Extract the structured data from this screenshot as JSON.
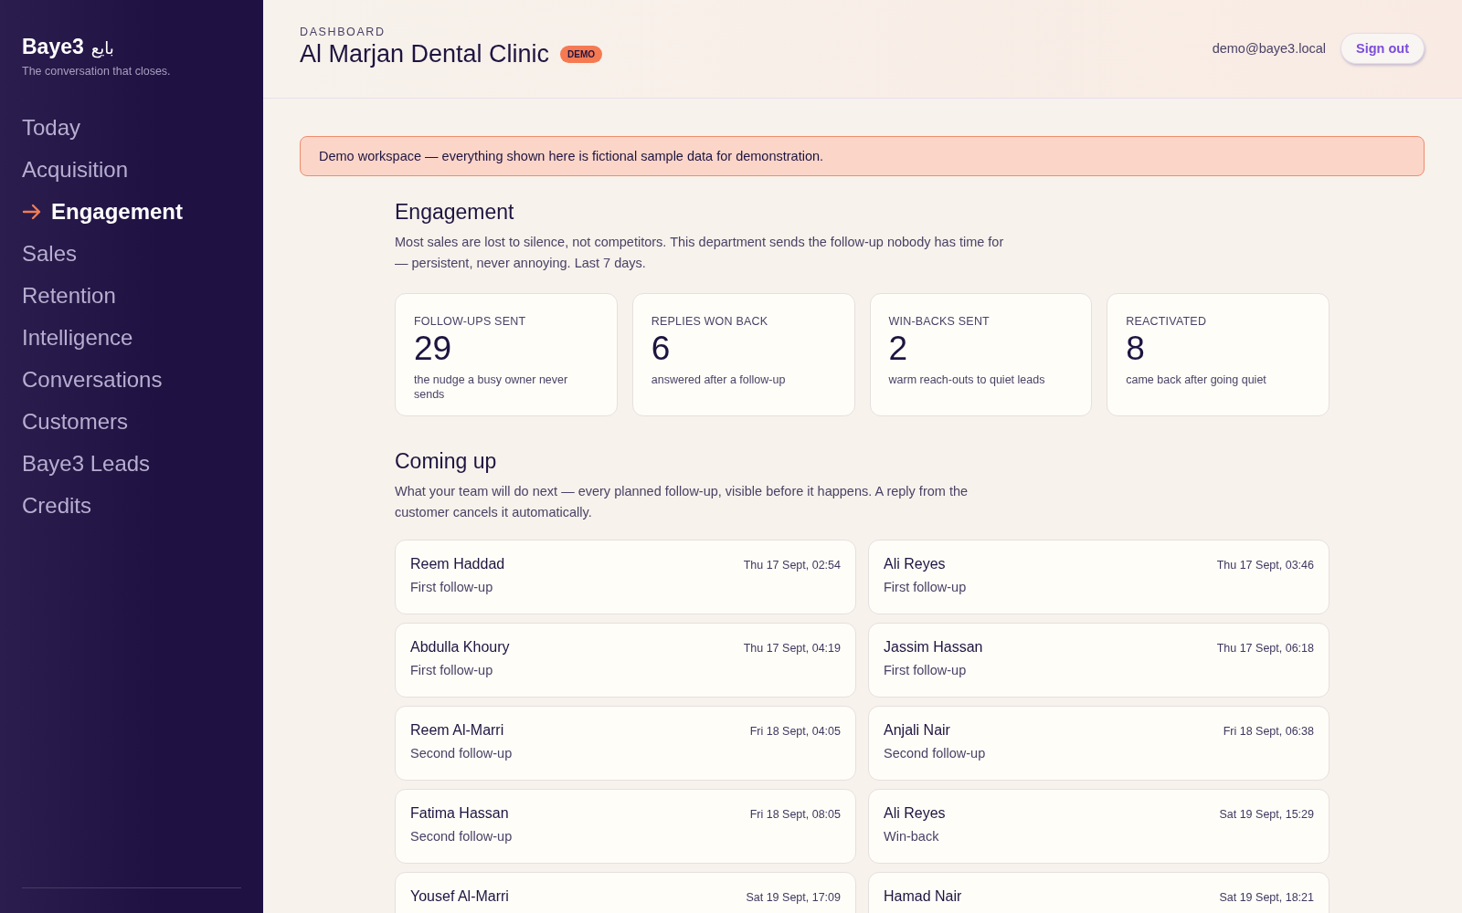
{
  "brand": {
    "name": "Baye3",
    "arabic": "بايع",
    "tagline": "The conversation that closes."
  },
  "nav": [
    {
      "label": "Today",
      "selected": false
    },
    {
      "label": "Acquisition",
      "selected": false
    },
    {
      "label": "Engagement",
      "selected": true
    },
    {
      "label": "Sales",
      "selected": false
    },
    {
      "label": "Retention",
      "selected": false
    },
    {
      "label": "Intelligence",
      "selected": false
    },
    {
      "label": "Conversations",
      "selected": false
    },
    {
      "label": "Customers",
      "selected": false
    },
    {
      "label": "Baye3 Leads",
      "selected": false
    },
    {
      "label": "Credits",
      "selected": false
    }
  ],
  "header": {
    "eyebrow": "DASHBOARD",
    "title": "Al Marjan Dental Clinic",
    "badge": "DEMO",
    "email": "demo@baye3.local",
    "sign_out": "Sign out"
  },
  "banner": "Demo workspace — everything shown here is fictional sample data for demonstration.",
  "engagement": {
    "title": "Engagement",
    "description": "Most sales are lost to silence, not competitors. This department sends the follow-up nobody has time for — persistent, never annoying. Last 7 days.",
    "stats": [
      {
        "label": "FOLLOW-UPS SENT",
        "value": "29",
        "note": "the nudge a busy owner never sends"
      },
      {
        "label": "REPLIES WON BACK",
        "value": "6",
        "note": "answered after a follow-up"
      },
      {
        "label": "WIN-BACKS SENT",
        "value": "2",
        "note": "warm reach-outs to quiet leads"
      },
      {
        "label": "REACTIVATED",
        "value": "8",
        "note": "came back after going quiet"
      }
    ]
  },
  "coming_up": {
    "title": "Coming up",
    "description": "What your team will do next — every planned follow-up, visible before it happens. A reply from the customer cancels it automatically.",
    "items": [
      {
        "name": "Reem Haddad",
        "time": "Thu 17 Sept, 02:54",
        "step": "First follow-up"
      },
      {
        "name": "Ali Reyes",
        "time": "Thu 17 Sept, 03:46",
        "step": "First follow-up"
      },
      {
        "name": "Abdulla Khoury",
        "time": "Thu 17 Sept, 04:19",
        "step": "First follow-up"
      },
      {
        "name": "Jassim Hassan",
        "time": "Thu 17 Sept, 06:18",
        "step": "First follow-up"
      },
      {
        "name": "Reem Al-Marri",
        "time": "Fri 18 Sept, 04:05",
        "step": "Second follow-up"
      },
      {
        "name": "Anjali Nair",
        "time": "Fri 18 Sept, 06:38",
        "step": "Second follow-up"
      },
      {
        "name": "Fatima Hassan",
        "time": "Fri 18 Sept, 08:05",
        "step": "Second follow-up"
      },
      {
        "name": "Ali Reyes",
        "time": "Sat 19 Sept, 15:29",
        "step": "Win-back"
      },
      {
        "name": "Yousef Al-Marri",
        "time": "Sat 19 Sept, 17:09"
      },
      {
        "name": "Hamad Nair",
        "time": "Sat 19 Sept, 18:21"
      }
    ]
  }
}
